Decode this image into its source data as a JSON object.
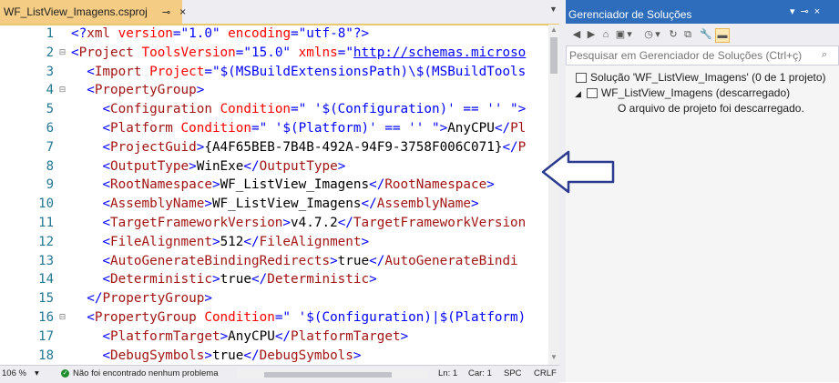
{
  "editor": {
    "tab_title": "WF_ListView_Imagens.csproj",
    "tab_pin": "⊸",
    "tab_close": "×",
    "lines": [
      {
        "n": "1",
        "fold": "",
        "segs": [
          [
            "br",
            "<?"
          ],
          [
            "tag",
            "xml "
          ],
          [
            "attr",
            "version"
          ],
          [
            "br",
            "="
          ],
          [
            "val",
            "\"1.0\""
          ],
          [
            "attr",
            " encoding"
          ],
          [
            "br",
            "="
          ],
          [
            "val",
            "\"utf-8\""
          ],
          [
            "br",
            "?>"
          ]
        ]
      },
      {
        "n": "2",
        "fold": "⊟",
        "segs": [
          [
            "br",
            "<"
          ],
          [
            "tag",
            "Project "
          ],
          [
            "attr",
            "ToolsVersion"
          ],
          [
            "br",
            "="
          ],
          [
            "val",
            "\"15.0\""
          ],
          [
            "attr",
            " xmlns"
          ],
          [
            "br",
            "="
          ],
          [
            "val",
            "\""
          ],
          [
            "link",
            "http://schemas.microso"
          ]
        ]
      },
      {
        "n": "3",
        "fold": "",
        "segs": [
          [
            "txt",
            "  "
          ],
          [
            "br",
            "<"
          ],
          [
            "tag",
            "Import "
          ],
          [
            "attr",
            "Project"
          ],
          [
            "br",
            "="
          ],
          [
            "val",
            "\"$(MSBuildExtensionsPath)\\$(MSBuildTools"
          ]
        ]
      },
      {
        "n": "4",
        "fold": "⊟",
        "segs": [
          [
            "txt",
            "  "
          ],
          [
            "br",
            "<"
          ],
          [
            "tag",
            "PropertyGroup"
          ],
          [
            "br",
            ">"
          ]
        ]
      },
      {
        "n": "5",
        "fold": "",
        "segs": [
          [
            "txt",
            "    "
          ],
          [
            "br",
            "<"
          ],
          [
            "tag",
            "Configuration "
          ],
          [
            "attr",
            "Condition"
          ],
          [
            "br",
            "="
          ],
          [
            "val",
            "\" '$(Configuration)' == '' \""
          ],
          [
            "br",
            ">"
          ]
        ]
      },
      {
        "n": "6",
        "fold": "",
        "segs": [
          [
            "txt",
            "    "
          ],
          [
            "br",
            "<"
          ],
          [
            "tag",
            "Platform "
          ],
          [
            "attr",
            "Condition"
          ],
          [
            "br",
            "="
          ],
          [
            "val",
            "\" '$(Platform)' == '' \""
          ],
          [
            "br",
            ">"
          ],
          [
            "txt",
            "AnyCPU"
          ],
          [
            "br",
            "</"
          ],
          [
            "tag",
            "Pl"
          ]
        ]
      },
      {
        "n": "7",
        "fold": "",
        "segs": [
          [
            "txt",
            "    "
          ],
          [
            "br",
            "<"
          ],
          [
            "tag",
            "ProjectGuid"
          ],
          [
            "br",
            ">"
          ],
          [
            "txt",
            "{A4F65BEB-7B4B-492A-94F9-3758F006C071}"
          ],
          [
            "br",
            "</"
          ],
          [
            "tag",
            "P"
          ]
        ]
      },
      {
        "n": "8",
        "fold": "",
        "segs": [
          [
            "txt",
            "    "
          ],
          [
            "br",
            "<"
          ],
          [
            "tag",
            "OutputType"
          ],
          [
            "br",
            ">"
          ],
          [
            "txt",
            "WinExe"
          ],
          [
            "br",
            "</"
          ],
          [
            "tag",
            "OutputType"
          ],
          [
            "br",
            ">"
          ]
        ]
      },
      {
        "n": "9",
        "fold": "",
        "segs": [
          [
            "txt",
            "    "
          ],
          [
            "br",
            "<"
          ],
          [
            "tag",
            "RootNamespace"
          ],
          [
            "br",
            ">"
          ],
          [
            "txt",
            "WF_ListView_Imagens"
          ],
          [
            "br",
            "</"
          ],
          [
            "tag",
            "RootNamespace"
          ],
          [
            "br",
            ">"
          ]
        ]
      },
      {
        "n": "10",
        "fold": "",
        "segs": [
          [
            "txt",
            "    "
          ],
          [
            "br",
            "<"
          ],
          [
            "tag",
            "AssemblyName"
          ],
          [
            "br",
            ">"
          ],
          [
            "txt",
            "WF_ListView_Imagens"
          ],
          [
            "br",
            "</"
          ],
          [
            "tag",
            "AssemblyName"
          ],
          [
            "br",
            ">"
          ]
        ]
      },
      {
        "n": "11",
        "fold": "",
        "segs": [
          [
            "txt",
            "    "
          ],
          [
            "br",
            "<"
          ],
          [
            "tag",
            "TargetFrameworkVersion"
          ],
          [
            "br",
            ">"
          ],
          [
            "txt",
            "v4.7.2"
          ],
          [
            "br",
            "</"
          ],
          [
            "tag",
            "TargetFrameworkVersion"
          ]
        ]
      },
      {
        "n": "12",
        "fold": "",
        "segs": [
          [
            "txt",
            "    "
          ],
          [
            "br",
            "<"
          ],
          [
            "tag",
            "FileAlignment"
          ],
          [
            "br",
            ">"
          ],
          [
            "txt",
            "512"
          ],
          [
            "br",
            "</"
          ],
          [
            "tag",
            "FileAlignment"
          ],
          [
            "br",
            ">"
          ]
        ]
      },
      {
        "n": "13",
        "fold": "",
        "segs": [
          [
            "txt",
            "    "
          ],
          [
            "br",
            "<"
          ],
          [
            "tag",
            "AutoGenerateBindingRedirects"
          ],
          [
            "br",
            ">"
          ],
          [
            "txt",
            "true"
          ],
          [
            "br",
            "</"
          ],
          [
            "tag",
            "AutoGenerateBindi"
          ]
        ]
      },
      {
        "n": "14",
        "fold": "",
        "segs": [
          [
            "txt",
            "    "
          ],
          [
            "br",
            "<"
          ],
          [
            "tag",
            "Deterministic"
          ],
          [
            "br",
            ">"
          ],
          [
            "txt",
            "true"
          ],
          [
            "br",
            "</"
          ],
          [
            "tag",
            "Deterministic"
          ],
          [
            "br",
            ">"
          ]
        ]
      },
      {
        "n": "15",
        "fold": "",
        "segs": [
          [
            "txt",
            "  "
          ],
          [
            "br",
            "</"
          ],
          [
            "tag",
            "PropertyGroup"
          ],
          [
            "br",
            ">"
          ]
        ]
      },
      {
        "n": "16",
        "fold": "⊟",
        "segs": [
          [
            "txt",
            "  "
          ],
          [
            "br",
            "<"
          ],
          [
            "tag",
            "PropertyGroup "
          ],
          [
            "attr",
            "Condition"
          ],
          [
            "br",
            "="
          ],
          [
            "val",
            "\" '$(Configuration)|$(Platform)"
          ]
        ]
      },
      {
        "n": "17",
        "fold": "",
        "segs": [
          [
            "txt",
            "    "
          ],
          [
            "br",
            "<"
          ],
          [
            "tag",
            "PlatformTarget"
          ],
          [
            "br",
            ">"
          ],
          [
            "txt",
            "AnyCPU"
          ],
          [
            "br",
            "</"
          ],
          [
            "tag",
            "PlatformTarget"
          ],
          [
            "br",
            ">"
          ]
        ]
      },
      {
        "n": "18",
        "fold": "",
        "segs": [
          [
            "txt",
            "    "
          ],
          [
            "br",
            "<"
          ],
          [
            "tag",
            "DebugSymbols"
          ],
          [
            "br",
            ">"
          ],
          [
            "txt",
            "true"
          ],
          [
            "br",
            "</"
          ],
          [
            "tag",
            "DebugSymbols"
          ],
          [
            "br",
            ">"
          ]
        ]
      }
    ]
  },
  "statusbar": {
    "zoom": "106 %",
    "message": "Não foi encontrado nenhum problema",
    "line": "Ln: 1",
    "col": "Car: 1",
    "mode": "SPC",
    "eol": "CRLF"
  },
  "solution_explorer": {
    "title": "Gerenciador de Soluções",
    "search_placeholder": "Pesquisar em Gerenciador de Soluções (Ctrl+ç)",
    "solution_node": "Solução 'WF_ListView_Imagens' (0 de 1 projeto)",
    "project_node": "WF_ListView_Imagens (descarregado)",
    "project_message": "O arquivo de projeto foi descarregado."
  },
  "colors": {
    "tag": "#a31515",
    "bracket": "#0000ff",
    "attribute": "#ff0000",
    "value": "#0000ff",
    "title_bar": "#2d6dbb",
    "active_tab": "#f5cc84",
    "arrow": "#2b3a8f"
  }
}
